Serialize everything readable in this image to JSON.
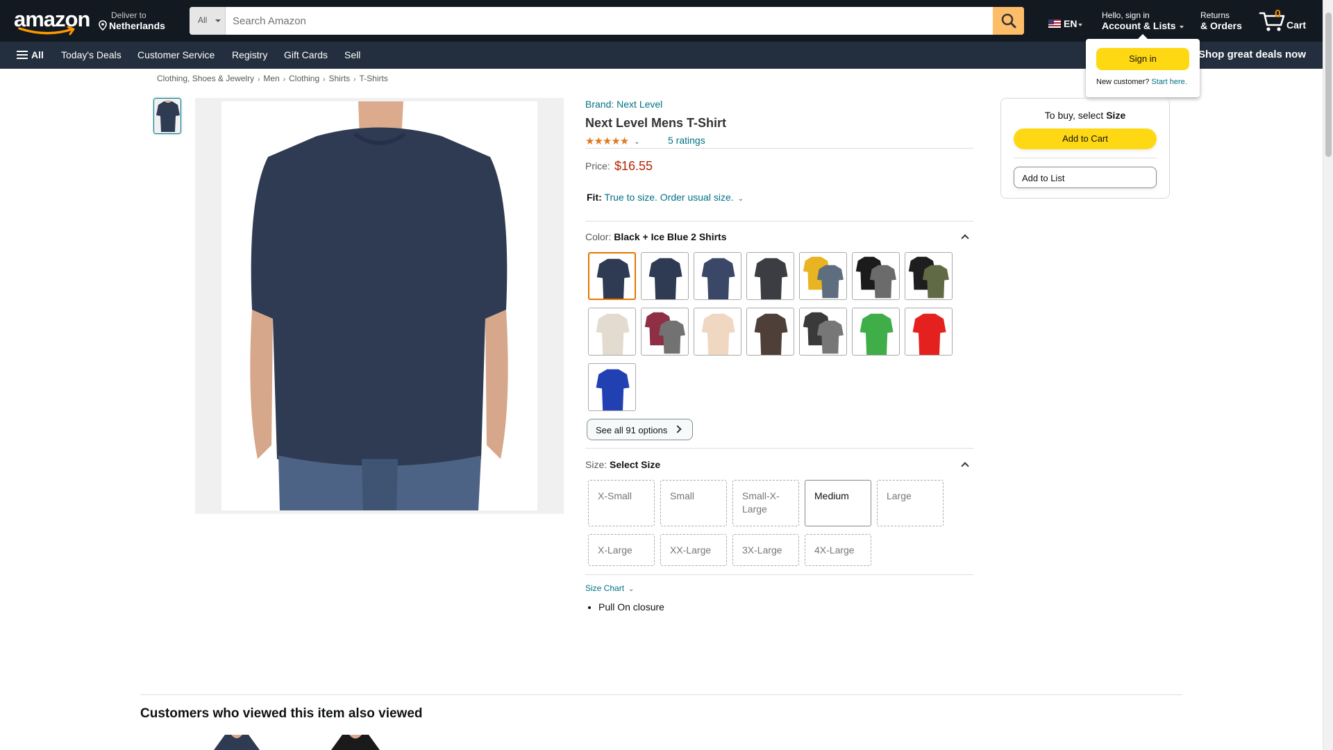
{
  "header": {
    "logo": "amazon",
    "deliver_line1": "Deliver to",
    "deliver_line2": "Netherlands",
    "search_category": "All",
    "search_placeholder": "Search Amazon",
    "language": "EN",
    "account_line1": "Hello, sign in",
    "account_line2": "Account & Lists",
    "returns_line1": "Returns",
    "returns_line2": "& Orders",
    "cart_count": "0",
    "cart_label": "Cart"
  },
  "subnav": {
    "all": "All",
    "items": [
      "Today's Deals",
      "Customer Service",
      "Registry",
      "Gift Cards",
      "Sell"
    ],
    "promo": "Shop great deals now"
  },
  "signin_popover": {
    "button": "Sign in",
    "new_customer": "New customer?",
    "start_here": "Start here."
  },
  "breadcrumb": [
    "Clothing, Shoes & Jewelry",
    "Men",
    "Clothing",
    "Shirts",
    "T-Shirts"
  ],
  "product": {
    "brand": "Brand: Next Level",
    "title": "Next Level Mens T-Shirt",
    "stars": "★★★★★",
    "rating_value": 5,
    "ratings_count": "5 ratings",
    "price_label": "Price:",
    "price": "$16.55",
    "fit_label": "Fit:",
    "fit_value": "True to size. Order usual size.",
    "color_label": "Color:",
    "color_value": "Black + Ice Blue 2 Shirts",
    "see_all": "See all 91 options",
    "size_label": "Size:",
    "size_value": "Select Size",
    "sizes": [
      "X-Small",
      "Small",
      "Small-X-Large",
      "Medium",
      "Large",
      "X-Large",
      "XX-Large",
      "3X-Large",
      "4X-Large"
    ],
    "size_chart": "Size Chart",
    "bullets": [
      "Pull On closure"
    ]
  },
  "swatch_colors": [
    [
      "#2f3b52"
    ],
    [
      "#2f3b52"
    ],
    [
      "#3a4766"
    ],
    [
      "#3c3d42"
    ],
    [
      "#e8b422",
      "#5f6e7e"
    ],
    [
      "#1b1b1b",
      "#6b6b6b"
    ],
    [
      "#1e1e1e",
      "#606b45"
    ],
    [
      "#e3dbcf"
    ],
    [
      "#8e2f45",
      "#727272"
    ],
    [
      "#efd7c2"
    ],
    [
      "#4e3f38"
    ],
    [
      "#3a3a3a",
      "#777"
    ],
    [
      "#3fad48"
    ],
    [
      "#e5211f"
    ],
    [
      "#2141b3"
    ]
  ],
  "buybox": {
    "prompt": "To buy, select",
    "prompt_bold": "Size",
    "add_to_cart": "Add to Cart",
    "add_to_list": "Add to List"
  },
  "bottom": {
    "also_viewed": "Customers who viewed this item also viewed"
  },
  "colors": {
    "header_bg": "#131921",
    "subnav_bg": "#232f3e",
    "search_button": "#febd69",
    "link": "#007185",
    "price": "#b12704",
    "primary_button": "#ffd814",
    "star": "#de7921",
    "selected_swatch": "#e77600",
    "shirt": "#2f3b52"
  }
}
